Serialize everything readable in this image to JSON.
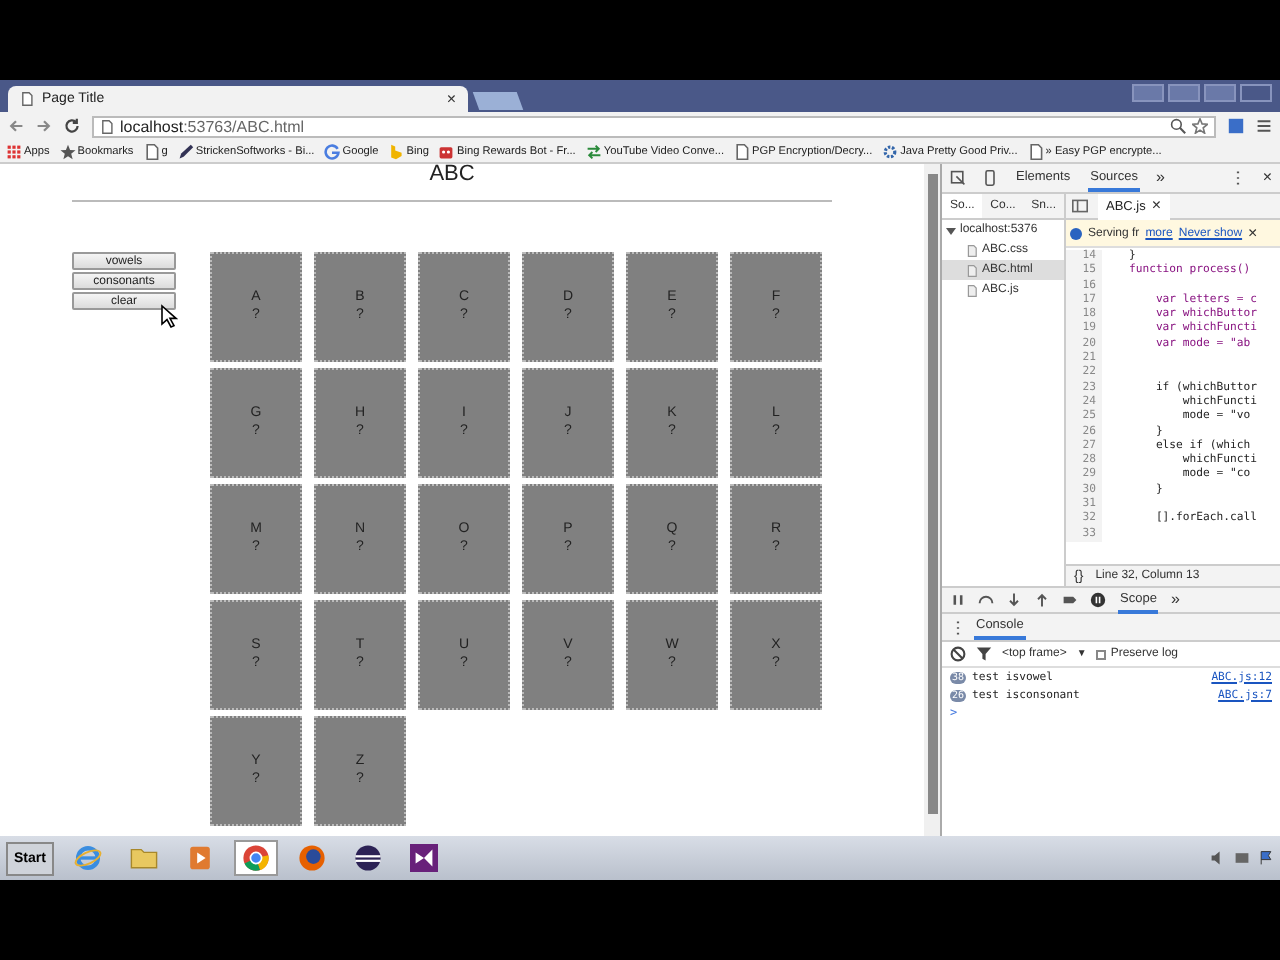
{
  "browser": {
    "tab_title": "Page Title",
    "tab_close": "×",
    "url_host": "localhost",
    "url_rest": ":53763/ABC.html",
    "bookmarks": [
      {
        "label": "Apps",
        "kind": "apps"
      },
      {
        "label": "Bookmarks",
        "kind": "star"
      },
      {
        "label": "g",
        "kind": "page"
      },
      {
        "label": "StrickenSoftworks - Bi...",
        "kind": "pen"
      },
      {
        "label": "Google",
        "kind": "google"
      },
      {
        "label": "Bing",
        "kind": "bing"
      },
      {
        "label": "Bing Rewards Bot - Fr...",
        "kind": "bot"
      },
      {
        "label": "YouTube Video Conve...",
        "kind": "arrows"
      },
      {
        "label": "PGP Encryption/Decry...",
        "kind": "page"
      },
      {
        "label": "Java Pretty Good Priv...",
        "kind": "gear"
      },
      {
        "label": "» Easy PGP encrypte...",
        "kind": "page"
      }
    ]
  },
  "page": {
    "heading": "ABC",
    "buttons": [
      "vowels",
      "consonants",
      "clear"
    ],
    "tiles": [
      {
        "letter": "A",
        "mark": "?"
      },
      {
        "letter": "B",
        "mark": "?"
      },
      {
        "letter": "C",
        "mark": "?"
      },
      {
        "letter": "D",
        "mark": "?"
      },
      {
        "letter": "E",
        "mark": "?"
      },
      {
        "letter": "F",
        "mark": "?"
      },
      {
        "letter": "G",
        "mark": "?"
      },
      {
        "letter": "H",
        "mark": "?"
      },
      {
        "letter": "I",
        "mark": "?"
      },
      {
        "letter": "J",
        "mark": "?"
      },
      {
        "letter": "K",
        "mark": "?"
      },
      {
        "letter": "L",
        "mark": "?"
      },
      {
        "letter": "M",
        "mark": "?"
      },
      {
        "letter": "N",
        "mark": "?"
      },
      {
        "letter": "O",
        "mark": "?"
      },
      {
        "letter": "P",
        "mark": "?"
      },
      {
        "letter": "Q",
        "mark": "?"
      },
      {
        "letter": "R",
        "mark": "?"
      },
      {
        "letter": "S",
        "mark": "?"
      },
      {
        "letter": "T",
        "mark": "?"
      },
      {
        "letter": "U",
        "mark": "?"
      },
      {
        "letter": "V",
        "mark": "?"
      },
      {
        "letter": "W",
        "mark": "?"
      },
      {
        "letter": "X",
        "mark": "?"
      },
      {
        "letter": "Y",
        "mark": "?"
      },
      {
        "letter": "Z",
        "mark": "?"
      }
    ]
  },
  "devtools": {
    "tabs": [
      {
        "label": "Elements",
        "selected": false
      },
      {
        "label": "Sources",
        "selected": true
      }
    ],
    "more": "»",
    "close": "×",
    "navigator_tabs": [
      {
        "label": "So...",
        "selected": true
      },
      {
        "label": "Co...",
        "selected": false
      },
      {
        "label": "Sn...",
        "selected": false
      }
    ],
    "tree": {
      "label": "localhost:5376",
      "expanded": true,
      "children": [
        {
          "label": "ABC.css",
          "selected": false
        },
        {
          "label": "ABC.html",
          "selected": true
        },
        {
          "label": "ABC.js",
          "selected": false
        }
      ]
    },
    "editor_tab": "ABC.js",
    "editor_tab_close": "×",
    "infobar": {
      "text": "Serving fr",
      "link1": "more",
      "link2": "Never show",
      "close": "×"
    },
    "code": [
      {
        "n": "14",
        "text": "    }"
      },
      {
        "n": "15",
        "text": "    function process()"
      },
      {
        "n": "16"
      },
      {
        "n": "17",
        "text": "        var letters = c"
      },
      {
        "n": "18",
        "text": "        var whichButtor"
      },
      {
        "n": "19",
        "text": "        var whichFuncti"
      },
      {
        "n": "20",
        "text": "        var mode = \"ab"
      },
      {
        "n": "21"
      },
      {
        "n": "22"
      },
      {
        "n": "23",
        "text": "        if (whichButtor"
      },
      {
        "n": "24",
        "text": "            whichFuncti"
      },
      {
        "n": "25",
        "text": "            mode = \"vo"
      },
      {
        "n": "26",
        "text": "        }"
      },
      {
        "n": "27",
        "text": "        else if (which"
      },
      {
        "n": "28",
        "text": "            whichFuncti"
      },
      {
        "n": "29",
        "text": "            mode = \"co"
      },
      {
        "n": "30",
        "text": "        }"
      },
      {
        "n": "31"
      },
      {
        "n": "32",
        "text": "        [].forEach.call"
      },
      {
        "n": "33"
      }
    ],
    "format_button": "{}",
    "status": "Line 32, Column 13",
    "pane_tab": "Scope",
    "pane_more": "»",
    "console": {
      "tab": "Console",
      "context": "<top frame>",
      "context_arrow": "▼",
      "preserve_log": {
        "label": "Preserve log",
        "checked": false
      },
      "messages": [
        {
          "count": "38",
          "text": "test isvowel",
          "source": "ABC.js:12"
        },
        {
          "count": "26",
          "text": "test isconsonant",
          "source": "ABC.js:7"
        }
      ],
      "prompt": ">"
    }
  },
  "taskbar": {
    "start": "Start",
    "apps": [
      {
        "kind": "ie",
        "active": false
      },
      {
        "kind": "folder",
        "active": false
      },
      {
        "kind": "media",
        "active": false
      },
      {
        "kind": "chrome",
        "active": true
      },
      {
        "kind": "firefox",
        "active": false
      },
      {
        "kind": "eclipse",
        "active": false
      },
      {
        "kind": "vs",
        "active": false
      }
    ]
  }
}
